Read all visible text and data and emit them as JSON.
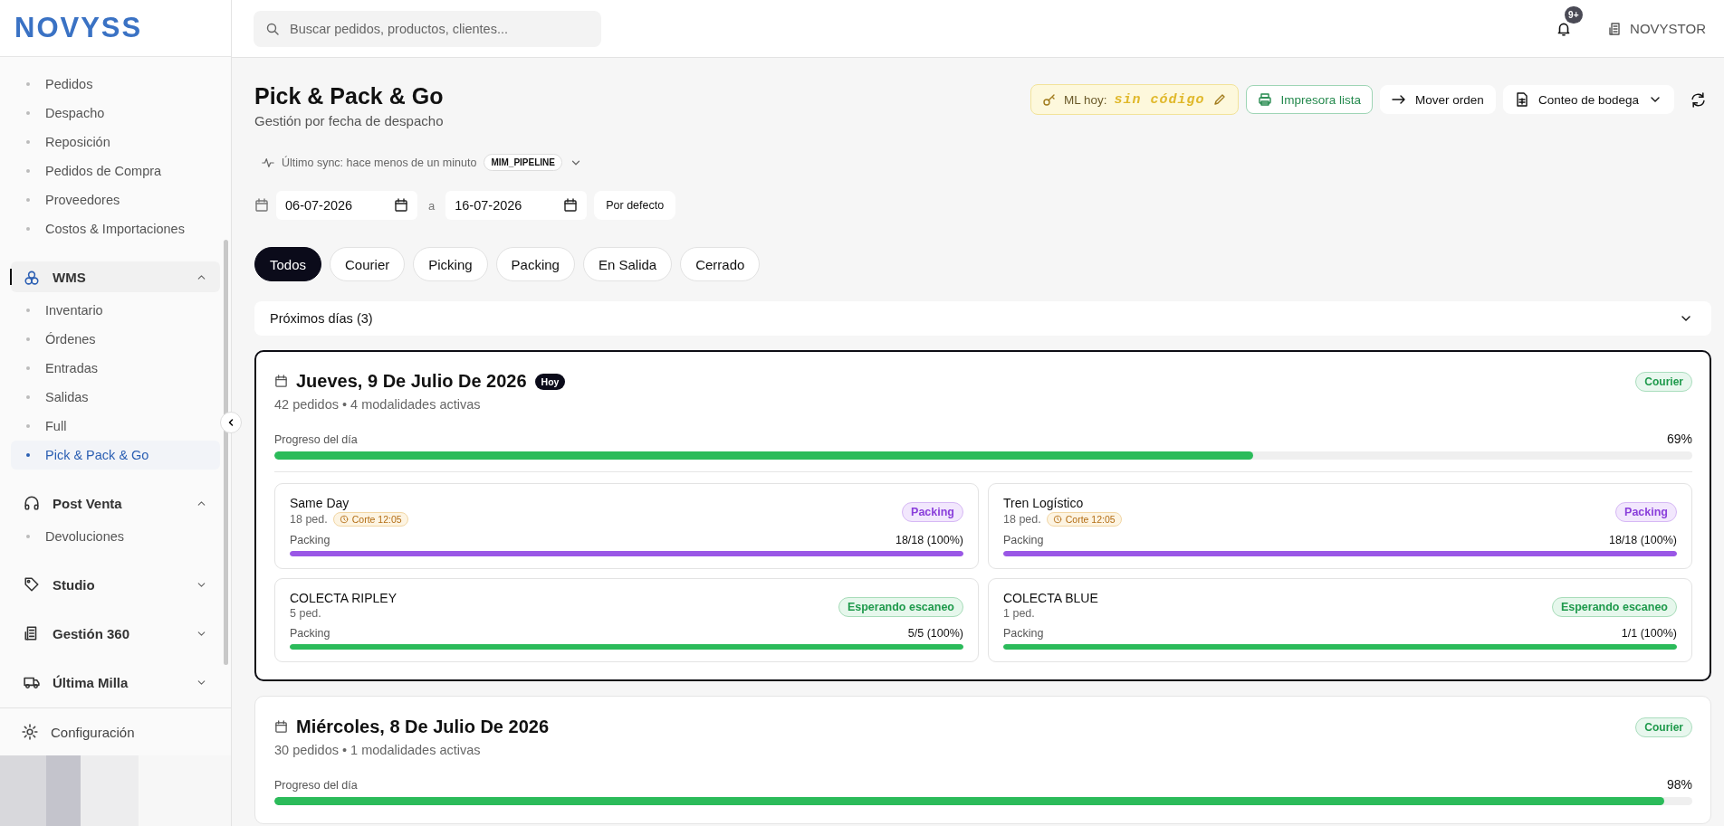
{
  "sidebar": {
    "logo": "NOVYSS",
    "top_items": [
      {
        "label": "Pedidos",
        "selected": false
      },
      {
        "label": "Despacho",
        "selected": false
      },
      {
        "label": "Reposición",
        "selected": false
      },
      {
        "label": "Pedidos de Compra",
        "selected": false
      },
      {
        "label": "Proveedores",
        "selected": false
      },
      {
        "label": "Costos & Importaciones",
        "selected": false
      }
    ],
    "groups": [
      {
        "label": "WMS",
        "expanded": true,
        "selected": true,
        "children": [
          {
            "label": "Inventario",
            "selected": false
          },
          {
            "label": "Órdenes",
            "selected": false
          },
          {
            "label": "Entradas",
            "selected": false
          },
          {
            "label": "Salidas",
            "selected": false
          },
          {
            "label": "Full",
            "selected": false
          },
          {
            "label": "Pick & Pack & Go",
            "selected": true
          }
        ]
      },
      {
        "label": "Post Venta",
        "expanded": true,
        "selected": false,
        "children": [
          {
            "label": "Devoluciones",
            "selected": false
          }
        ]
      },
      {
        "label": "Studio",
        "expanded": false,
        "selected": false
      },
      {
        "label": "Gestión 360",
        "expanded": false,
        "selected": false
      },
      {
        "label": "Última Milla",
        "expanded": false,
        "selected": false
      }
    ],
    "settings": "Configuración"
  },
  "header": {
    "search": {
      "placeholder": "Buscar pedidos, productos, clientes..."
    },
    "notifications": "9+",
    "account": "NOVYSTOR"
  },
  "page": {
    "title": "Pick & Pack & Go",
    "subtitle": "Gestión por fecha de despacho",
    "toolbar": {
      "ml_label": "ML hoy:",
      "ml_value": "sin código",
      "printer": "Impresora lista",
      "move": "Mover orden",
      "count": "Conteo de bodega"
    },
    "sync": {
      "text": "Último sync: hace menos de un minuto",
      "tag": "MIM_PIPELINE"
    },
    "dates": {
      "from": "06-07-2026",
      "separator": "a",
      "to": "16-07-2026",
      "reset": "Por defecto"
    },
    "filters": [
      {
        "label": "Todos",
        "selected": true
      },
      {
        "label": "Courier",
        "selected": false
      },
      {
        "label": "Picking",
        "selected": false
      },
      {
        "label": "Packing",
        "selected": false
      },
      {
        "label": "En Salida",
        "selected": false
      },
      {
        "label": "Cerrado",
        "selected": false
      }
    ],
    "upcoming": {
      "label": "Próximos días (3)",
      "expanded": false
    },
    "days": [
      {
        "title": "Jueves, 9 De Julio De 2026",
        "today": "Hoy",
        "selected": true,
        "summary": "42 pedidos • 4 modalidades activas",
        "badge": "Courier",
        "progress_label": "Progreso del día",
        "reading": "69%",
        "level": 0.69,
        "modalities": [
          {
            "name": "Same Day",
            "count": "18 ped.",
            "cutoff": "Corte 12:05",
            "status": {
              "kind": "packing",
              "label": "Packing"
            },
            "stage": "Packing",
            "reading": "18/18 (100%)",
            "level": 1
          },
          {
            "name": "Tren Logístico",
            "count": "18 ped.",
            "cutoff": "Corte 12:05",
            "status": {
              "kind": "packing",
              "label": "Packing"
            },
            "stage": "Packing",
            "reading": "18/18 (100%)",
            "level": 1
          },
          {
            "name": "COLECTA RIPLEY",
            "count": "5 ped.",
            "status": {
              "kind": "waiting",
              "label": "Esperando escaneo"
            },
            "stage": "Packing",
            "reading": "5/5 (100%)",
            "level": 1
          },
          {
            "name": "COLECTA BLUE",
            "count": "1 ped.",
            "status": {
              "kind": "waiting",
              "label": "Esperando escaneo"
            },
            "stage": "Packing",
            "reading": "1/1 (100%)",
            "level": 1
          }
        ]
      },
      {
        "title": "Miércoles, 8 De Julio De 2026",
        "selected": false,
        "summary": "30 pedidos • 1 modalidades activas",
        "badge": "Courier",
        "progress_label": "Progreso del día",
        "reading": "98%",
        "level": 0.98
      }
    ]
  }
}
